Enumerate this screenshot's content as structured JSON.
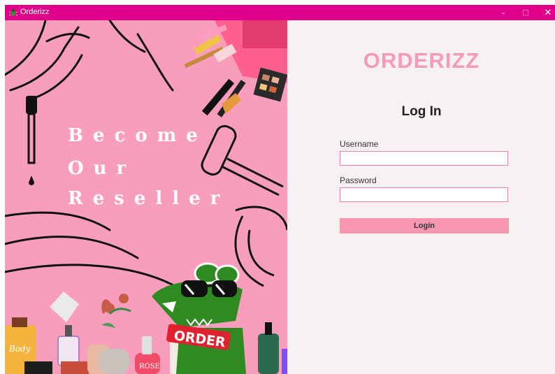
{
  "window": {
    "title": "Orderizz",
    "app_icon": "bug-app-icon",
    "controls": {
      "minimize": "–",
      "maximize": "□",
      "close": "✕"
    },
    "accent": "#e0008a"
  },
  "promo": {
    "line1": "Become",
    "line2": "Our",
    "line3": "Reseller"
  },
  "illustration": {
    "shown_text": [
      "ORDER",
      "Body",
      "ROSE"
    ],
    "background": "#f89dbb"
  },
  "login": {
    "brand": "ORDERIZZ",
    "heading": "Log In",
    "username_label": "Username",
    "username_value": "",
    "password_label": "Password",
    "password_value": "",
    "button_label": "Login",
    "brand_color": "#f59ab8",
    "button_color": "#f796b3"
  }
}
